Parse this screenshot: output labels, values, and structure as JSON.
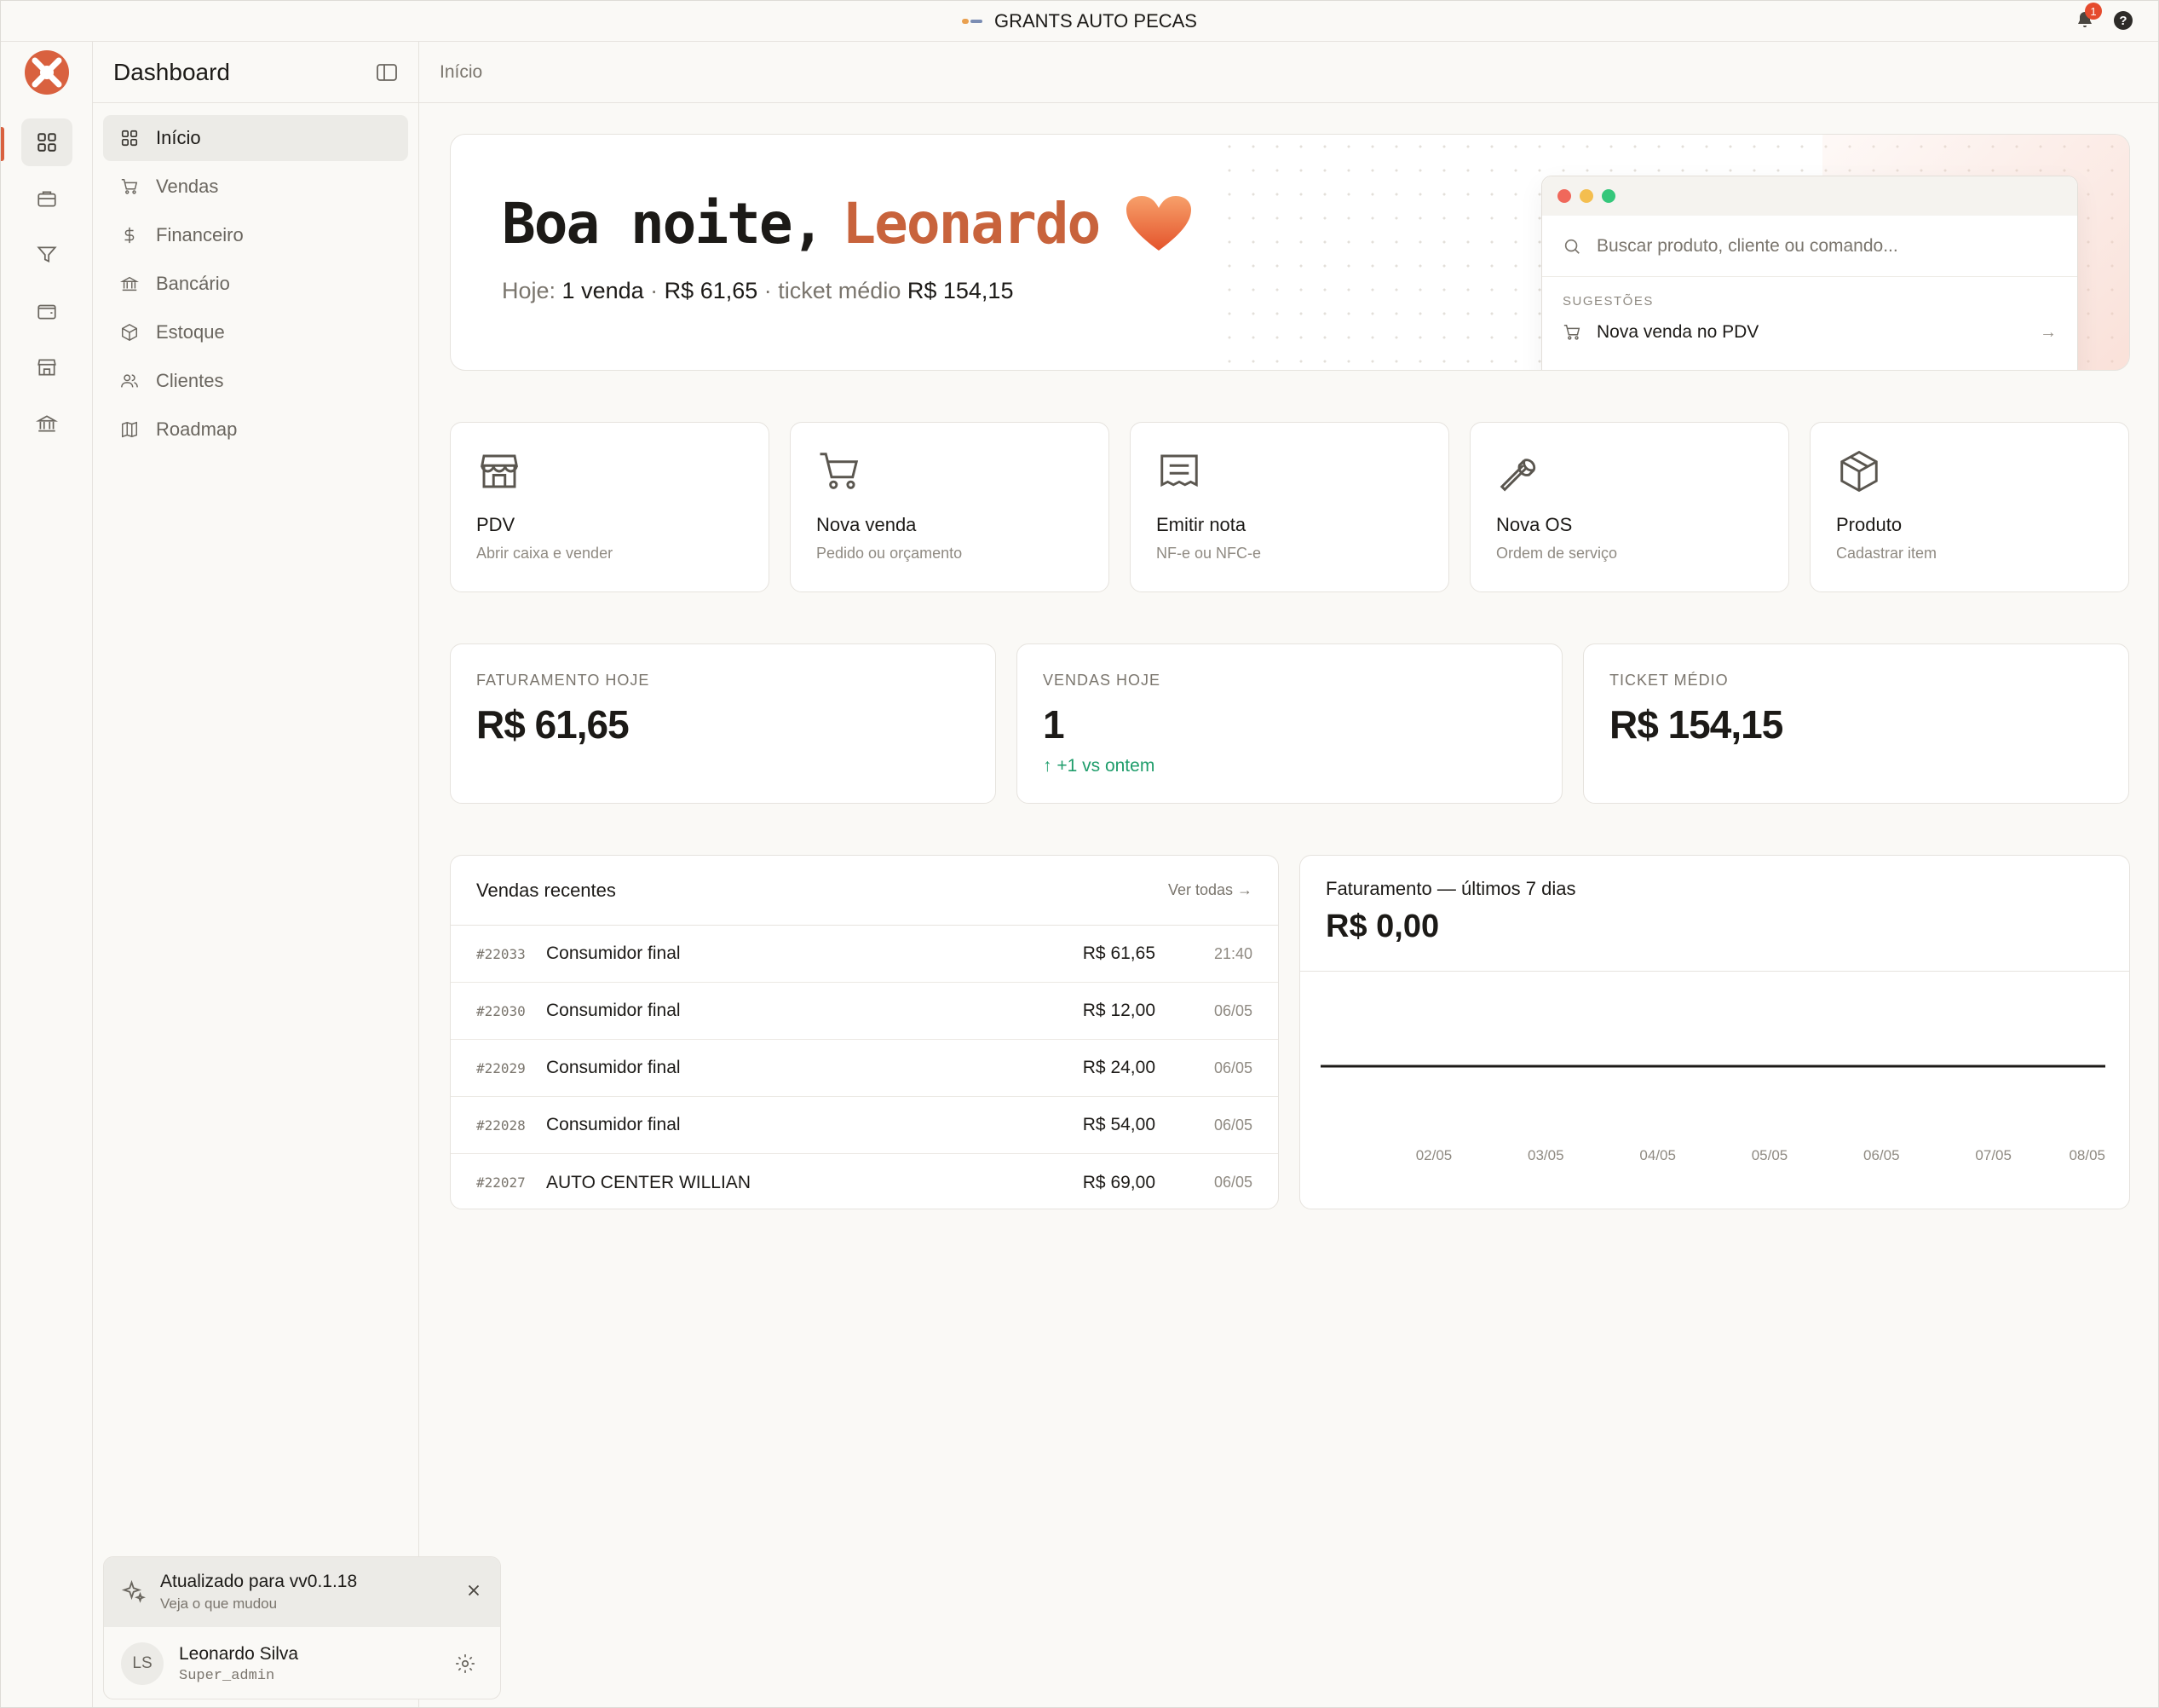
{
  "window": {
    "title": "GRANTS AUTO PECAS",
    "notifications": "1",
    "help": "?"
  },
  "sidebar": {
    "title": "Dashboard",
    "items": [
      {
        "label": "Início",
        "icon": "grid-icon"
      },
      {
        "label": "Vendas",
        "icon": "cart-icon"
      },
      {
        "label": "Financeiro",
        "icon": "dollar-icon"
      },
      {
        "label": "Bancário",
        "icon": "bank-icon"
      },
      {
        "label": "Estoque",
        "icon": "box-icon"
      },
      {
        "label": "Clientes",
        "icon": "users-icon"
      },
      {
        "label": "Roadmap",
        "icon": "map-icon"
      }
    ],
    "update": {
      "title": "Atualizado para vv0.1.18",
      "subtitle": "Veja o que mudou"
    },
    "user": {
      "initials": "LS",
      "name": "Leonardo Silva",
      "role": "Super_admin"
    }
  },
  "breadcrumb": "Início",
  "hero": {
    "greeting": "Boa noite,",
    "name": "Leonardo",
    "summary": {
      "hoje_label": "Hoje:",
      "vendas": "1 venda",
      "sep1": "·",
      "valor": "R$ 61,65",
      "ticket_label": "· ticket médio",
      "ticket": "R$ 154,15"
    },
    "command": {
      "placeholder": "Buscar produto, cliente ou comando...",
      "section": "SUGESTÕES",
      "suggestion": "Nova venda no PDV"
    }
  },
  "quick_actions": [
    {
      "label": "PDV",
      "sub": "Abrir caixa e vender",
      "icon": "store-icon"
    },
    {
      "label": "Nova venda",
      "sub": "Pedido ou orçamento",
      "icon": "cart-icon"
    },
    {
      "label": "Emitir nota",
      "sub": "NF-e ou NFC-e",
      "icon": "receipt-icon"
    },
    {
      "label": "Nova OS",
      "sub": "Ordem de serviço",
      "icon": "wrench-icon"
    },
    {
      "label": "Produto",
      "sub": "Cadastrar item",
      "icon": "package-icon"
    }
  ],
  "kpis": [
    {
      "label": "FATURAMENTO HOJE",
      "value": "R$ 61,65",
      "delta": ""
    },
    {
      "label": "VENDAS HOJE",
      "value": "1",
      "delta": "↑  +1 vs ontem"
    },
    {
      "label": "TICKET MÉDIO",
      "value": "R$ 154,15",
      "delta": ""
    }
  ],
  "recent_sales": {
    "title": "Vendas recentes",
    "link": "Ver todas →",
    "rows": [
      {
        "id": "#22033",
        "customer": "Consumidor final",
        "amount": "R$ 61,65",
        "time": "21:40"
      },
      {
        "id": "#22030",
        "customer": "Consumidor final",
        "amount": "R$ 12,00",
        "time": "06/05"
      },
      {
        "id": "#22029",
        "customer": "Consumidor final",
        "amount": "R$ 24,00",
        "time": "06/05"
      },
      {
        "id": "#22028",
        "customer": "Consumidor final",
        "amount": "R$ 54,00",
        "time": "06/05"
      },
      {
        "id": "#22027",
        "customer": "AUTO CENTER WILLIAN",
        "amount": "R$ 69,00",
        "time": "06/05"
      }
    ]
  },
  "revenue_card": {
    "title": "Faturamento — últimos 7 dias",
    "total": "R$ 0,00"
  },
  "chart_data": {
    "type": "line",
    "title": "Faturamento — últimos 7 dias",
    "categories": [
      "02/05",
      "03/05",
      "04/05",
      "05/05",
      "06/05",
      "07/05",
      "08/05"
    ],
    "series": [
      {
        "values": [
          0,
          0,
          0,
          0,
          0,
          0,
          0
        ]
      }
    ],
    "grid": false,
    "legend": "none"
  },
  "colors": {
    "accent": "#d9613f",
    "name": "#c8633c",
    "positive": "#1f9d6b",
    "background": "#faf9f6"
  }
}
